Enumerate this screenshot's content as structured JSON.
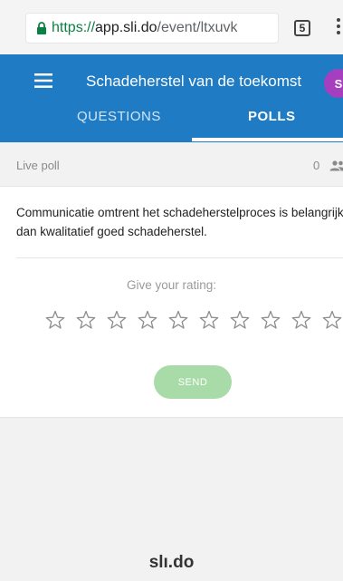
{
  "browser": {
    "url_scheme": "https://",
    "url_host": "app.sli.do",
    "url_path": "/event/ltxuvk",
    "tab_count": "5",
    "lock_icon": "lock-icon",
    "menu_icon": "more-vert-icon"
  },
  "appbar": {
    "title": "Schadeherstel van de toekomst",
    "avatar_initial": "S",
    "avatar_color": "#a53fc0",
    "bar_color": "#1f7bc4",
    "menu_icon": "hamburger-icon",
    "tabs": [
      {
        "label": "QUESTIONS",
        "active": false
      },
      {
        "label": "POLLS",
        "active": true
      }
    ]
  },
  "poll": {
    "status_label": "Live poll",
    "participant_count": "0",
    "participant_icon": "people-icon",
    "question": "Communicatie omtrent het schadeherstelproces is belangrijker dan kwalitatief goed schadeherstel.",
    "rating_prompt": "Give your rating:",
    "star_count": 10,
    "star_icon": "star-outline-icon",
    "send_label": "SEND",
    "send_color": "#a9dba9"
  },
  "footer": {
    "logo_text": "slı.do"
  }
}
